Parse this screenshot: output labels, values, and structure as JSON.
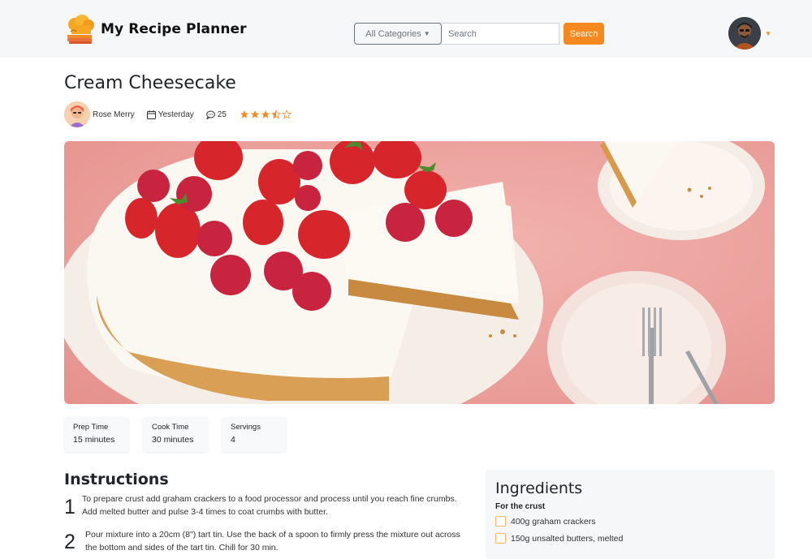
{
  "brand": {
    "title": "My Recipe Planner"
  },
  "search": {
    "category_label": "All Categories",
    "placeholder": "Search",
    "button_label": "Search"
  },
  "recipe": {
    "title": "Cream Cheesecake",
    "author": "Rose Merry",
    "date": "Yesterday",
    "comments": "25",
    "rating": 3.5,
    "rating_max": 5
  },
  "info": [
    {
      "label": "Prep Time",
      "value": "15 minutes"
    },
    {
      "label": "Cook Time",
      "value": "30 minutes"
    },
    {
      "label": "Servings",
      "value": "4"
    }
  ],
  "instructions": {
    "title": "Instructions",
    "steps": [
      {
        "number": "1",
        "line1": "To prepare crust add graham crackers to a food processor and process until you reach fine crumbs.",
        "line2": "Add melted butter and pulse 3-4 times to coat crumbs with butter."
      },
      {
        "number": "2",
        "line1": "Pour mixture into a 20cm (8\") tart tin. Use the back of a spoon to firmly press the mixture out across",
        "line2": "the bottom and sides of the tart tin. Chill for 30 min."
      }
    ]
  },
  "ingredients": {
    "title": "Ingredients",
    "section": "For the crust",
    "items": [
      "400g graham crackers",
      "150g unsalted butters, melted"
    ]
  },
  "colors": {
    "accent": "#f5891f",
    "header_bg": "#f6f7f8",
    "star": "#f5891f"
  },
  "icons": {
    "logo": "chef-hat-icon",
    "date": "calendar-icon",
    "comments": "chat-bubble-icon",
    "caret": "caret-down-icon"
  }
}
